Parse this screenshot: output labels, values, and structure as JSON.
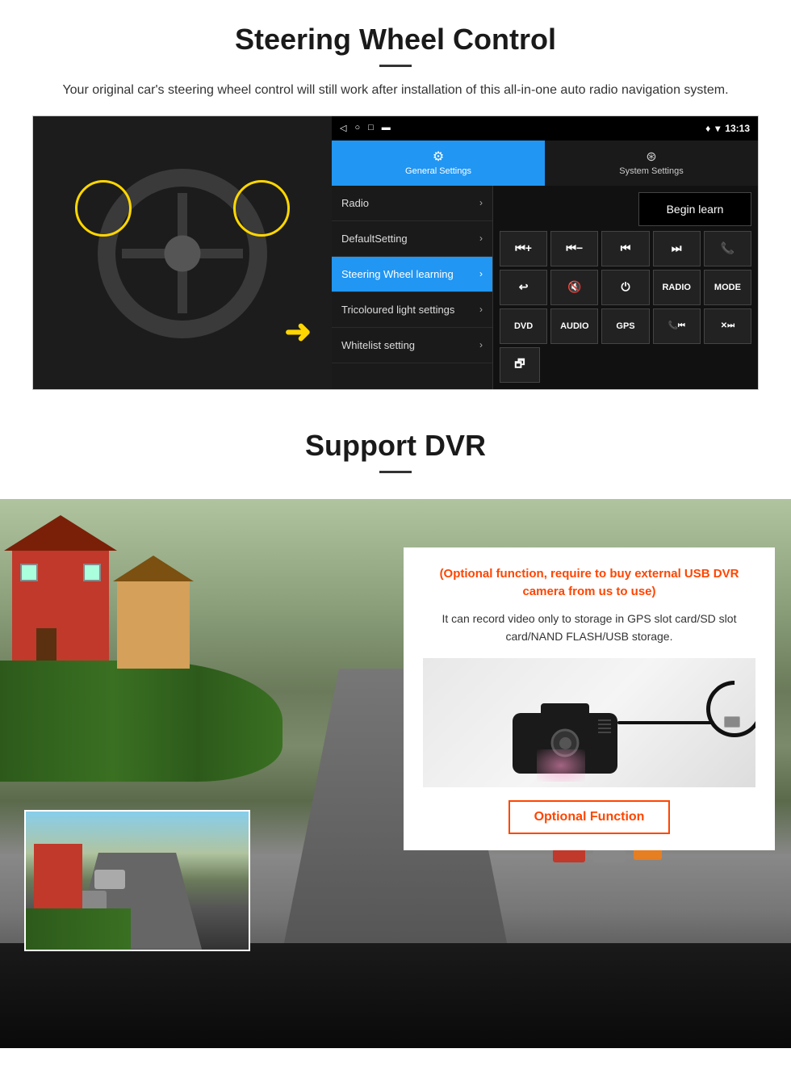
{
  "steering": {
    "title": "Steering Wheel Control",
    "description": "Your original car's steering wheel control will still work after installation of this all-in-one auto radio navigation system.",
    "statusbar": {
      "icons_left": [
        "◁",
        "○",
        "□",
        "▬"
      ],
      "time": "13:13",
      "signal_icon": "▼",
      "wifi_icon": "▾"
    },
    "tabs": [
      {
        "label": "General Settings",
        "icon": "⚙",
        "active": true
      },
      {
        "label": "System Settings",
        "icon": "⊗",
        "active": false
      }
    ],
    "menu_items": [
      {
        "label": "Radio",
        "active": false
      },
      {
        "label": "DefaultSetting",
        "active": false
      },
      {
        "label": "Steering Wheel learning",
        "active": true
      },
      {
        "label": "Tricoloured light settings",
        "active": false
      },
      {
        "label": "Whitelist setting",
        "active": false
      }
    ],
    "begin_learn": "Begin learn",
    "control_buttons": [
      [
        "⏮+",
        "⏮-",
        "⏮|",
        "|⏭",
        "📞"
      ],
      [
        "↩",
        "🔇x",
        "⏻",
        "RADIO",
        "MODE"
      ],
      [
        "DVD",
        "AUDIO",
        "GPS",
        "📞⏮|",
        "✕|⏭"
      ],
      [
        "🗗"
      ]
    ]
  },
  "dvr": {
    "title": "Support DVR",
    "optional_text": "(Optional function, require to buy external USB DVR camera from us to use)",
    "description": "It can record video only to storage in GPS slot card/SD slot card/NAND FLASH/USB storage.",
    "optional_button_label": "Optional Function"
  }
}
